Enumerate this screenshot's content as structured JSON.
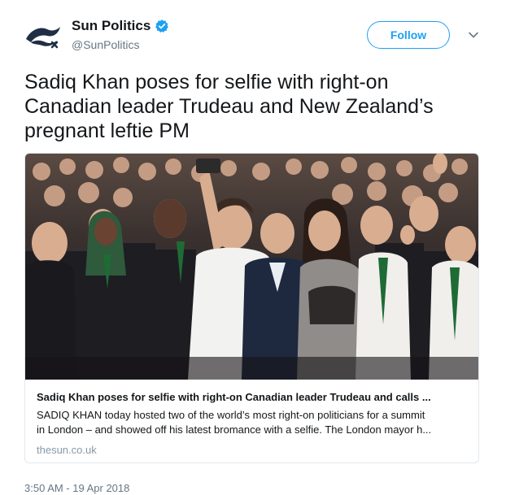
{
  "author": {
    "display_name": "Sun Politics",
    "handle": "@SunPolitics",
    "verified": true,
    "avatar_icon": "sun-politics-logo-icon",
    "verified_icon": "verified-badge-icon"
  },
  "actions": {
    "follow_label": "Follow",
    "menu_icon": "chevron-down-icon"
  },
  "tweet": {
    "text_line1": "Sadiq Khan poses for selfie with right-on",
    "text_line2": "Canadian leader Trudeau and New Zealand’s",
    "text_line3": "pregnant leftie PM",
    "timestamp": "3:50 AM - 19 Apr 2018"
  },
  "card": {
    "image_description_icon": "photo-selfie-crowd",
    "title": "Sadiq Khan poses for selfie with right-on Canadian leader Trudeau and calls ...",
    "description_line1": "SADIQ KHAN today hosted two of the world’s most right-on politicians for a summit",
    "description_line2": "in London – and showed off his latest bromance with a selfie. The London mayor h...",
    "domain": "thesun.co.uk"
  },
  "colors": {
    "accent": "#1da1f2",
    "text": "#14171a",
    "secondary": "#657786",
    "border": "#e1e8ed",
    "avatar_navy": "#1f2e45"
  }
}
